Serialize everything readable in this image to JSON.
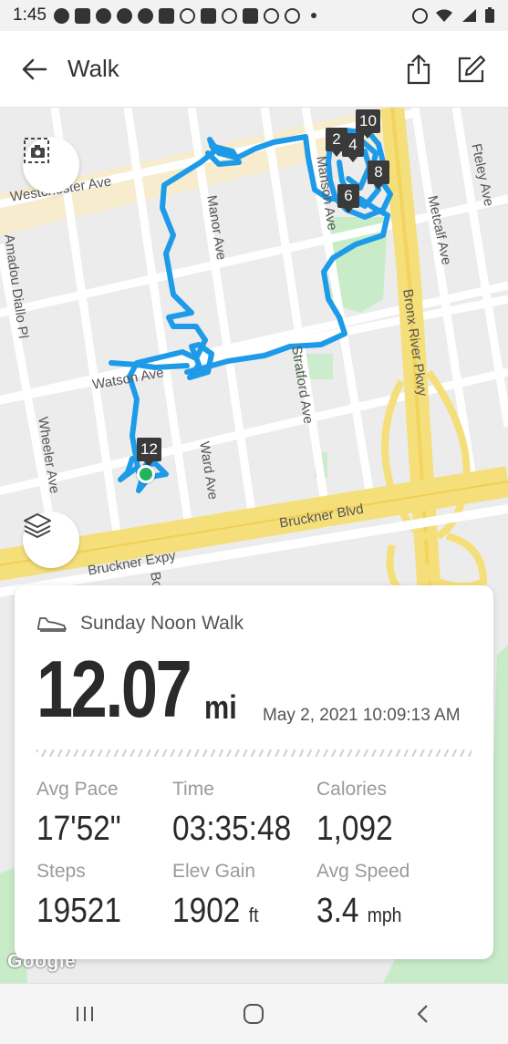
{
  "status_bar": {
    "time": "1:45"
  },
  "header": {
    "title": "Walk"
  },
  "map": {
    "streets": {
      "westchester": "Westchester Ave",
      "manor": "Manor Ave",
      "manson": "Manson Ave",
      "metcalf": "Metcalf Ave",
      "fteley": "Fteley Ave",
      "amadou": "Amadou Diallo Pl",
      "watson": "Watson Ave",
      "stratford": "Stratford Ave",
      "bronx_river": "Bronx River Pkwy",
      "wheeler": "Wheeler Ave",
      "ward": "Ward Ave",
      "bruckner_blvd": "Bruckner Blvd",
      "bruckner_expy": "Bruckner Expy",
      "bo": "Bo"
    },
    "markers": [
      "2",
      "4",
      "10",
      "8",
      "6",
      "12"
    ],
    "attribution": "Google",
    "route_color": "#1e9be8"
  },
  "activity": {
    "name": "Sunday Noon Walk",
    "distance": "12.07",
    "distance_unit": "mi",
    "date": "May 2, 2021 10:09:13 AM"
  },
  "stats": {
    "avg_pace": {
      "label": "Avg Pace",
      "value": "17'52\""
    },
    "time": {
      "label": "Time",
      "value": "03:35:48"
    },
    "calories": {
      "label": "Calories",
      "value": "1,092"
    },
    "steps": {
      "label": "Steps",
      "value": "19521"
    },
    "elev_gain": {
      "label": "Elev Gain",
      "value": "1902",
      "unit": "ft"
    },
    "avg_speed": {
      "label": "Avg Speed",
      "value": "3.4",
      "unit": "mph"
    }
  }
}
